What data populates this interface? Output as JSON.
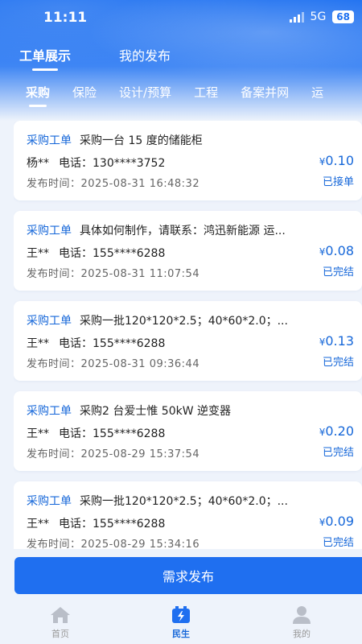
{
  "status": {
    "time": "11:11",
    "network": "5G",
    "battery": "68"
  },
  "top_tabs": [
    {
      "label": "工单展示",
      "active": true
    },
    {
      "label": "我的发布",
      "active": false
    }
  ],
  "category_tabs": [
    {
      "label": "采购",
      "active": true
    },
    {
      "label": "保险"
    },
    {
      "label": "设计/预算"
    },
    {
      "label": "工程"
    },
    {
      "label": "备案并网"
    },
    {
      "label": "运"
    }
  ],
  "phone_label": "电话：",
  "time_label": "发布时间：",
  "currency": "¥",
  "cards": [
    {
      "tag": "采购工单",
      "title": "采购一台 15 度的储能柜",
      "name": "杨**",
      "phone": "130****3752",
      "time": "2025-08-31 16:48:32",
      "price": "0.10",
      "state": "已接单"
    },
    {
      "tag": "采购工单",
      "title": "具体如何制作，请联系：鸿迅新能源 运...",
      "name": "王**",
      "phone": "155****6288",
      "time": "2025-08-31 11:07:54",
      "price": "0.08",
      "state": "已完结"
    },
    {
      "tag": "采购工单",
      "title": "采购一批120*120*2.5；40*60*2.0；...",
      "name": "王**",
      "phone": "155****6288",
      "time": "2025-08-31 09:36:44",
      "price": "0.13",
      "state": "已完结"
    },
    {
      "tag": "采购工单",
      "title": "采购2 台爱士惟 50kW 逆变器",
      "name": "王**",
      "phone": "155****6288",
      "time": "2025-08-29 15:37:54",
      "price": "0.20",
      "state": "已完结"
    },
    {
      "tag": "采购工单",
      "title": "采购一批120*120*2.5；40*60*2.0；...",
      "name": "王**",
      "phone": "155****6288",
      "time": "2025-08-29 15:34:16",
      "price": "0.09",
      "state": "已完结"
    }
  ],
  "publish_button": "需求发布",
  "tabbar": [
    {
      "label": "首页",
      "icon": "home-icon"
    },
    {
      "label": "民生",
      "icon": "battery-bolt-icon",
      "active": true
    },
    {
      "label": "我的",
      "icon": "user-icon"
    }
  ],
  "colors": {
    "primary": "#1f6ff0",
    "accent_text": "#1667d9",
    "background": "#eef3fb"
  }
}
